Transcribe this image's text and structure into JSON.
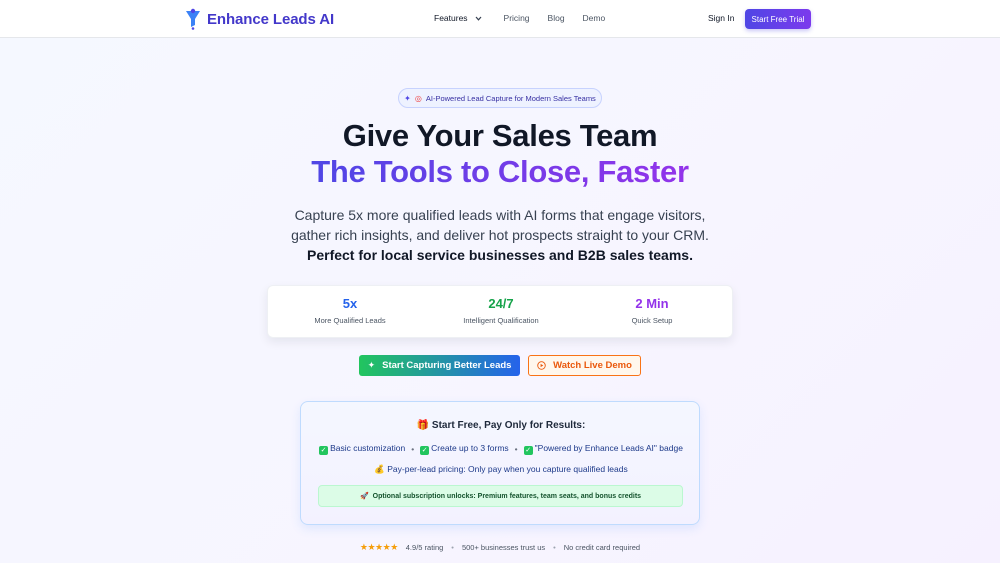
{
  "nav": {
    "brand": "Enhance Leads AI",
    "features": "Features",
    "pricing": "Pricing",
    "blog": "Blog",
    "demo": "Demo",
    "sign_in": "Sign In",
    "trial": "Start Free Trial"
  },
  "hero": {
    "badge": "AI-Powered Lead Capture for Modern Sales Teams",
    "title_line1": "Give Your Sales Team",
    "title_line2": "The Tools to Close, Faster",
    "sub_line1": "Capture 5x more qualified leads with AI forms that engage visitors,",
    "sub_line2": "gather rich insights, and deliver hot prospects straight to your CRM.",
    "sub_line3": "Perfect for local service businesses and B2B sales teams."
  },
  "stats": [
    {
      "value": "5x",
      "label": "More Qualified Leads"
    },
    {
      "value": "24/7",
      "label": "Intelligent Qualification"
    },
    {
      "value": "2 Min",
      "label": "Quick Setup"
    }
  ],
  "cta": {
    "primary": "Start Capturing Better Leads",
    "secondary": "Watch Live Demo"
  },
  "pricing_card": {
    "title": "Start Free, Pay Only for Results:",
    "features": [
      "Basic customization",
      "Create up to 3 forms",
      "\"Powered by Enhance Leads AI\" badge"
    ],
    "ppl": "Pay-per-lead pricing: Only pay when you capture qualified leads",
    "unlock": "Optional subscription unlocks: Premium features, team seats, and bonus credits"
  },
  "trust": {
    "stars": "★★★★★",
    "rating": "4.9/5 rating",
    "businesses": "500+ businesses trust us",
    "no_card": "No credit card required"
  },
  "colors": {
    "brand": "#4338ca",
    "accent_gradient_start": "#4f46e5",
    "accent_gradient_end": "#9333ea",
    "success": "#22c55e",
    "orange": "#f97316"
  },
  "icons": {
    "logo": "funnel-icon",
    "badge": "sparkle-icon",
    "primary_cta": "sparkle-icon",
    "secondary_cta": "play-circle-icon",
    "card_title": "gift-icon",
    "ppl": "money-bag-icon",
    "unlock": "rocket-icon"
  }
}
